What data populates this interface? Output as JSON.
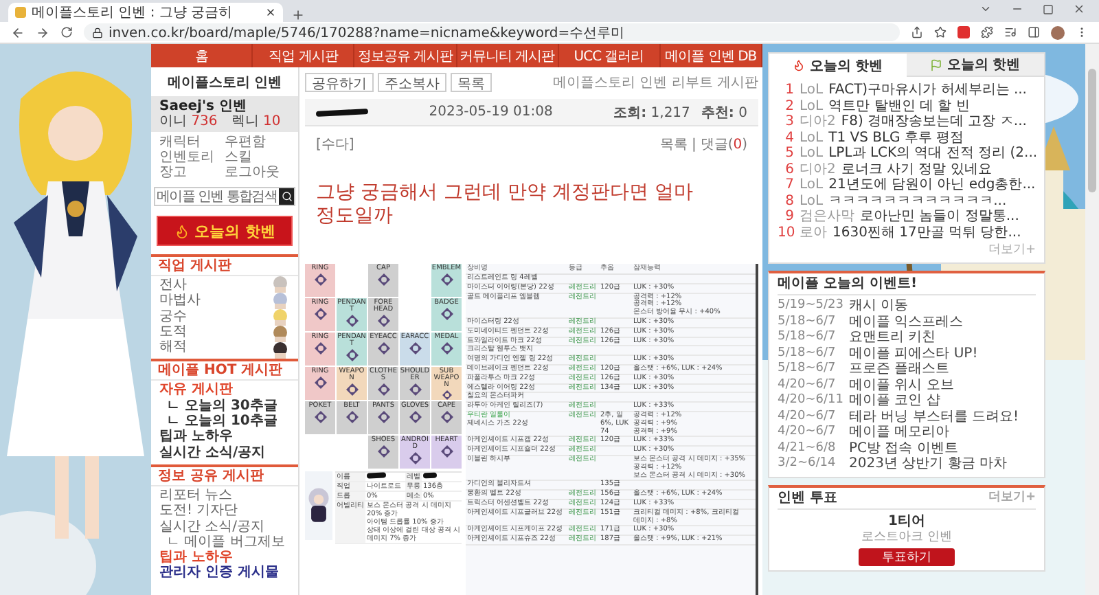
{
  "browser": {
    "tab_title": "메이플스토리 인벤 : 그냥 궁금히",
    "url": "inven.co.kr/board/maple/5746/170288?name=nicname&keyword=수선루미"
  },
  "nav": [
    "홈",
    "직업 게시판",
    "정보공유 게시판",
    "커뮤니티 게시판",
    "UCC 갤러리",
    "메이플 인벤 DB"
  ],
  "sidebar": {
    "title": "메이플스토리 인벤",
    "user": {
      "name": "Saeej's 인벤",
      "stats": [
        {
          "label": "이니",
          "value": "736"
        },
        {
          "label": "렉니",
          "value": "10"
        }
      ]
    },
    "links": [
      "캐릭터",
      "우편함",
      "인벤토리",
      "스킬",
      "장고",
      "로그아웃"
    ],
    "search": {
      "placeholder": "메이플 인벤 통합검색"
    },
    "banner": "오늘의 핫벤",
    "sections": [
      {
        "title": "직업 게시판",
        "sprites": true,
        "items": [
          {
            "label": "전사",
            "kind": "plain"
          },
          {
            "label": "마법사",
            "kind": "plain"
          },
          {
            "label": "궁수",
            "kind": "plain"
          },
          {
            "label": "도적",
            "kind": "plain"
          },
          {
            "label": "해적",
            "kind": "plain"
          }
        ]
      },
      {
        "title": "메이플 HOT 게시판",
        "items": [
          {
            "label": "자유 게시판",
            "kind": "highlight",
            "children": [
              {
                "label": "ㄴ 오늘의 30추글",
                "kind": "strong"
              },
              {
                "label": "ㄴ 오늘의 10추글",
                "kind": "strong"
              }
            ]
          },
          {
            "label": "팁과 노하우",
            "kind": "strong"
          },
          {
            "label": "실시간 소식/공지",
            "kind": "strong"
          }
        ]
      },
      {
        "title": "정보 공유 게시판",
        "items": [
          {
            "label": "리포터 뉴스",
            "kind": "plain"
          },
          {
            "label": "도전! 기자단",
            "kind": "plain"
          },
          {
            "label": "실시간 소식/공지",
            "kind": "plain",
            "children": [
              {
                "label": "ㄴ 메이플 버그제보",
                "kind": "plain"
              }
            ]
          },
          {
            "label": "팁과 노하우",
            "kind": "highlight"
          },
          {
            "label": "관리자 인증 게시물",
            "kind": "admin"
          }
        ]
      }
    ]
  },
  "post": {
    "buttons": [
      "공유하기",
      "주소복사",
      "목록"
    ],
    "board": "메이플스토리 인벤 리부트 게시판",
    "date": "2023-05-19 01:08",
    "views_label": "조회:",
    "views": "1,217",
    "likes_label": "추천:",
    "likes": "0",
    "category": "[수다]",
    "list_link": "목록",
    "separator": "|",
    "comments_prefix": "댓글(",
    "comments_count": "0",
    "comments_suffix": ")",
    "title_lines": [
      "그냥 궁금해서 그런데 만약 계정판다면 얼마",
      "정도일까"
    ]
  },
  "equipment": {
    "slots": [
      {
        "kind": "slot",
        "label": "RING",
        "color": "#f0c8c8"
      },
      {
        "kind": "empty"
      },
      {
        "kind": "slot",
        "label": "CAP",
        "color": "#cfcfcf"
      },
      {
        "kind": "empty"
      },
      {
        "kind": "slot",
        "label": "EMBLEM",
        "color": "#b9e0da"
      },
      {
        "kind": "slot",
        "label": "RING",
        "color": "#f0c8c8"
      },
      {
        "kind": "slot",
        "label": "PENDANT",
        "color": "#b9e0da"
      },
      {
        "kind": "slot",
        "label": "FORE HEAD",
        "color": "#cfcfcf"
      },
      {
        "kind": "empty"
      },
      {
        "kind": "slot",
        "label": "BADGE",
        "color": "#b9e0da"
      },
      {
        "kind": "slot",
        "label": "RING",
        "color": "#f0c8c8"
      },
      {
        "kind": "slot",
        "label": "PENDANT",
        "color": "#b9e0da"
      },
      {
        "kind": "slot",
        "label": "EYEACC",
        "color": "#cfcfcf"
      },
      {
        "kind": "slot",
        "label": "EARACC",
        "color": "#cadcea"
      },
      {
        "kind": "slot",
        "label": "MEDAL",
        "color": "#b9e0da"
      },
      {
        "kind": "slot",
        "label": "RING",
        "color": "#f0c8c8"
      },
      {
        "kind": "slot",
        "label": "WEAPON",
        "color": "#f2d8bb"
      },
      {
        "kind": "slot",
        "label": "CLOTHES",
        "color": "#cfcfcf"
      },
      {
        "kind": "slot",
        "label": "SHOULDER",
        "color": "#cfcfcf"
      },
      {
        "kind": "slot",
        "label": "SUB WEAPON",
        "color": "#f2d8bb"
      },
      {
        "kind": "slot",
        "label": "POKET",
        "color": "#cfcfcf"
      },
      {
        "kind": "slot",
        "label": "BELT",
        "color": "#cfcfcf"
      },
      {
        "kind": "slot",
        "label": "PANTS",
        "color": "#cfcfcf"
      },
      {
        "kind": "slot",
        "label": "GLOVES",
        "color": "#cfcfcf"
      },
      {
        "kind": "slot",
        "label": "CAPE",
        "color": "#cfcfcf"
      },
      {
        "kind": "empty"
      },
      {
        "kind": "empty"
      },
      {
        "kind": "slot",
        "label": "SHOES",
        "color": "#cfcfcf"
      },
      {
        "kind": "slot",
        "label": "ANDROID",
        "color": "#d9ccec"
      },
      {
        "kind": "slot",
        "label": "HEART",
        "color": "#d9ccec"
      }
    ],
    "info": [
      {
        "label": "이름",
        "redacted": true,
        "label2": "레벨",
        "redacted2": true
      },
      {
        "label": "직업",
        "value": "나이트로드",
        "label2": "무릉",
        "value2": "136층"
      },
      {
        "label": "드롭",
        "value": "0%",
        "label2": "메소",
        "value2": "0%"
      },
      {
        "label": "어빌리티",
        "lines": [
          "보스 몬스터 공격 시 데미지 20% 증가",
          "아이템 드롭률 10% 증가",
          "상태 이상에 걸린 대상 공격 시 데미지 7% 증가"
        ]
      }
    ],
    "columns": [
      "장비명",
      "등급",
      "추옵",
      "잠재능력"
    ],
    "rows": [
      {
        "kind": "section",
        "name": "리스트레인트 링 4레벨"
      },
      {
        "kind": "item",
        "name": "마이스터 이어링(본당) 22성",
        "grade": "레전드리",
        "flame": "120급",
        "potential": [
          "LUK : +30%"
        ]
      },
      {
        "kind": "item",
        "name": "골드 메이플리프 엠블렘",
        "grade": "레전드리",
        "potential": [
          "공격력 : +12%",
          "공격력 : +12%",
          "몬스터 방어율 무시 : +40%"
        ]
      },
      {
        "kind": "item",
        "name": "마이스터링 22성",
        "grade": "레전드리",
        "potential": [
          "LUK : +30%"
        ]
      },
      {
        "kind": "item",
        "name": "도미네이티드 펜던트 22성",
        "grade": "레전드리",
        "flame": "126급",
        "potential": [
          "LUK : +30%"
        ]
      },
      {
        "kind": "item",
        "name": "트와일라이트 마크 22성",
        "grade": "레전드리",
        "flame": "126급",
        "potential": [
          "LUK : +30%"
        ]
      },
      {
        "kind": "section",
        "name": "크리스탈 웬투스 뱃지"
      },
      {
        "kind": "item",
        "name": "여명의 가디언 엔젤 링 22성",
        "grade": "레전드리",
        "potential": [
          "LUK : +30%"
        ]
      },
      {
        "kind": "item",
        "name": "데이브레이크 펜던트 22성",
        "grade": "레전드리",
        "flame": "120급",
        "potential": [
          "올스탯 : +6%, LUK : +24%"
        ]
      },
      {
        "kind": "item",
        "name": "파풀라투스 마크 22성",
        "grade": "레전드리",
        "flame": "126급",
        "potential": [
          "LUK : +30%"
        ]
      },
      {
        "kind": "item",
        "name": "에스텔라 이어링 22성",
        "grade": "레전드리",
        "flame": "134급",
        "potential": [
          "LUK : +30%"
        ]
      },
      {
        "kind": "section",
        "name": "칠요의 몬스터파커"
      },
      {
        "kind": "item",
        "name": "라투아 아케인 릴리즈(7)",
        "grade": "레전드리",
        "potential": [
          "LUK : +33%"
        ]
      },
      {
        "kind": "item",
        "note": "우티란 일룰이",
        "name": "제네시스 가즈 22성",
        "grade": "레전드리",
        "flame": "2추, 일 6%, LUK 74",
        "potential": [
          "공격력 : +12%",
          "공격력 : +9%",
          "공격력 : +9%"
        ]
      },
      {
        "kind": "item",
        "name": "아케인셰이드 시프캡 22성",
        "grade": "레전드리",
        "flame": "120급",
        "potential": [
          "LUK : +33%"
        ]
      },
      {
        "kind": "item",
        "name": "아케인셰이드 시프숄더 22성",
        "grade": "레전드리",
        "potential": [
          "LUK : +30%"
        ]
      },
      {
        "kind": "item",
        "name": "이블린 하시부",
        "grade": "레전드리",
        "potential": [
          "보스 몬스터 공격 시 데미지 : +35%",
          "공격력 : +12%",
          "보스 몬스터 공격 시 데미지 : +30%"
        ]
      },
      {
        "kind": "item",
        "name": "가디언의 블리자드셔",
        "flame": "135급"
      },
      {
        "kind": "item",
        "name": "몽환의 벨트 22성",
        "grade": "레전드리",
        "flame": "156급",
        "potential": [
          "올스탯 : +6%, LUK : +24%"
        ]
      },
      {
        "kind": "item",
        "name": "트릭스터 어센션벨트 22성",
        "grade": "레전드리",
        "flame": "124급",
        "potential": [
          "LUK : +33%"
        ]
      },
      {
        "kind": "item",
        "name": "아케인셰이드 시프글러브 22성",
        "grade": "레전드리",
        "flame": "151급",
        "potential": [
          "크리티컬 데미지 : +8%, 크리티컬 데미지 : +8%"
        ]
      },
      {
        "kind": "item",
        "name": "아케인셰이드 시프케이프 22성",
        "grade": "레전드리",
        "flame": "171급",
        "potential": [
          "LUK : +30%"
        ]
      },
      {
        "kind": "item",
        "name": "아케인셰이드 시프슈즈 22성",
        "grade": "레전드리",
        "flame": "187급",
        "potential": [
          "올스탯 : +9%, LUK : +21%"
        ]
      }
    ]
  },
  "hot": {
    "tabs": [
      {
        "label": "오늘의 핫벤",
        "selected": true
      },
      {
        "label": "오늘의 핫벤",
        "selected": false
      }
    ],
    "items": [
      {
        "rank": "1",
        "category": "LoL",
        "title": "FACT)구마유시가 허세부리는 ..."
      },
      {
        "rank": "2",
        "category": "LoL",
        "title": "역트만 탈밴인 데 할 빈"
      },
      {
        "rank": "3",
        "category": "디아2",
        "title": "F8) 경매장송보는데 고장 ㅈ..."
      },
      {
        "rank": "4",
        "category": "LoL",
        "title": "T1 VS BLG 후루 평점"
      },
      {
        "rank": "5",
        "category": "LoL",
        "title": "LPL과 LCK의 역대 전적 정리 (2..."
      },
      {
        "rank": "6",
        "category": "디아2",
        "title": "로너크 사기 정말 있네요"
      },
      {
        "rank": "7",
        "category": "LoL",
        "title": "21년도에 담원이 아닌 edg총한..."
      },
      {
        "rank": "8",
        "category": "LoL",
        "title": "ㅋㅋㅋㅋㅋㅋㅋㅋㅋㅋㅋㅋ..."
      },
      {
        "rank": "9",
        "category": "검은사막",
        "title": "로아난민 놈들이 정말통..."
      },
      {
        "rank": "10",
        "category": "로아",
        "title": "1630찐해 17만골 먹튀 당한..."
      }
    ],
    "more": "더보기+"
  },
  "events": {
    "title": "메이플 오늘의 이벤트!",
    "items": [
      {
        "date": "5/19~5/23",
        "name": "캐시 이동"
      },
      {
        "date": "5/18~6/7",
        "name": "메이플 익스프레스"
      },
      {
        "date": "5/18~6/7",
        "name": "요맨트리 키친"
      },
      {
        "date": "5/18~6/7",
        "name": "메이플 피에스타 UP!"
      },
      {
        "date": "5/18~6/7",
        "name": "프로즌 플래스트"
      },
      {
        "date": "4/20~6/7",
        "name": "메이플 위시 오브"
      },
      {
        "date": "4/20~6/11",
        "name": "메이플 코인 샵"
      },
      {
        "date": "4/20~6/7",
        "name": "테라 버닝 부스터를 드려요!"
      },
      {
        "date": "4/20~6/7",
        "name": "메이플 메모리아"
      },
      {
        "date": "4/21~6/8",
        "name": "PC방 접속 이벤트"
      },
      {
        "date": "3/2~6/14",
        "name": "2023년 상반기 황금 마차"
      }
    ]
  },
  "vote": {
    "title": "인벤 투표",
    "more": "더보기+",
    "option": "1티어",
    "source": "로스트아크 인벤",
    "button": "투표하기"
  }
}
